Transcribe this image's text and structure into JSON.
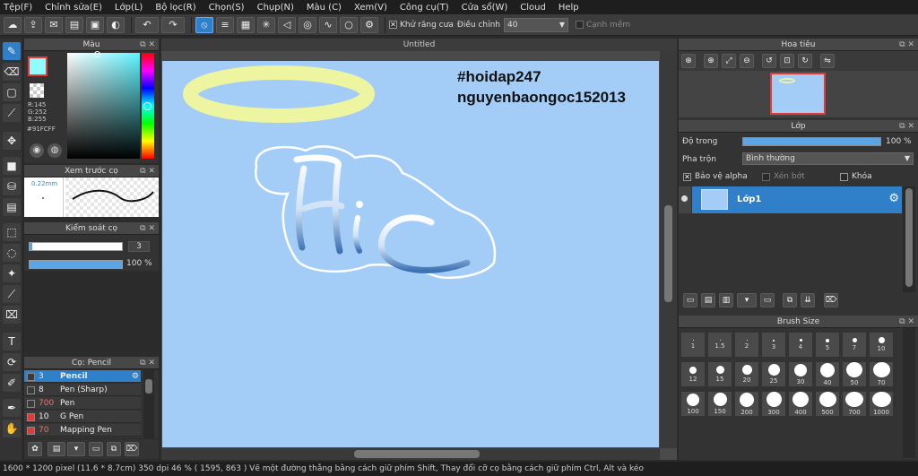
{
  "menu": [
    "Tệp(F)",
    "Chỉnh sửa(E)",
    "Lớp(L)",
    "Bộ lọc(R)",
    "Chọn(S)",
    "Chụp(N)",
    "Màu (C)",
    "Xem(V)",
    "Công cụ(T)",
    "Cửa sổ(W)",
    "Cloud",
    "Help"
  ],
  "toolbar": {
    "antialias_label": "Khử răng cưa",
    "correction_label": "Điều chỉnh",
    "correction_value": "40",
    "soft_edge_label": "Cạnh mềm"
  },
  "color_panel": {
    "title": "Màu",
    "r": "R:145",
    "g": "G:252",
    "b": "B:255",
    "hex": "#91FCFF"
  },
  "brush_preview": {
    "title": "Xem trước cọ",
    "size": "0.22mm"
  },
  "brush_control": {
    "title": "Kiểm soát cọ",
    "size_value": "3",
    "opacity_value": "100 %"
  },
  "brush_list": {
    "title": "Cọ: Pencil",
    "items": [
      {
        "size": "3",
        "name": "Pencil",
        "color": "#3a3a3a",
        "selected": true
      },
      {
        "size": "8",
        "name": "Pen (Sharp)",
        "color": "#3a3a3a",
        "selected": false
      },
      {
        "size": "700",
        "name": "Pen",
        "color": "#3a3a3a",
        "selected": false
      },
      {
        "size": "10",
        "name": "G Pen",
        "color": "#e53935",
        "selected": false
      },
      {
        "size": "70",
        "name": "Mapping Pen",
        "color": "#e53935",
        "selected": false
      }
    ]
  },
  "canvas": {
    "tab_title": "Untitled",
    "text_line1": "#hoidap247",
    "text_line2": "nguyenbaongoc152013",
    "background": "#a3cdf7"
  },
  "navigator": {
    "title": "Hoa tiêu"
  },
  "layer_panel": {
    "title": "Lớp",
    "opacity_label": "Độ trong",
    "opacity_value": "100 %",
    "blend_label": "Pha trộn",
    "blend_value": "Bình thường",
    "protect_alpha_label": "Bảo vệ alpha",
    "clipping_label": "Xén bớt",
    "lock_label": "Khóa",
    "layer_name": "Lớp1"
  },
  "brush_size_panel": {
    "title": "Brush Size",
    "sizes": [
      "1",
      "1.5",
      "2",
      "3",
      "4",
      "5",
      "7",
      "10",
      "12",
      "15",
      "20",
      "25",
      "30",
      "40",
      "50",
      "70",
      "100",
      "150",
      "200",
      "300",
      "400",
      "500",
      "700",
      "1000"
    ]
  },
  "status": "1600 * 1200 pixel  (11.6 * 8.7cm)  350 dpi  46 %  ( 1595, 863 )  Vẽ một đường thẳng bằng cách giữ phím Shift, Thay đổi cỡ cọ bằng cách giữ phím Ctrl, Alt và kéo",
  "colors": {
    "accent": "#2f7fc9",
    "foreground_color": "#91FCFF"
  }
}
